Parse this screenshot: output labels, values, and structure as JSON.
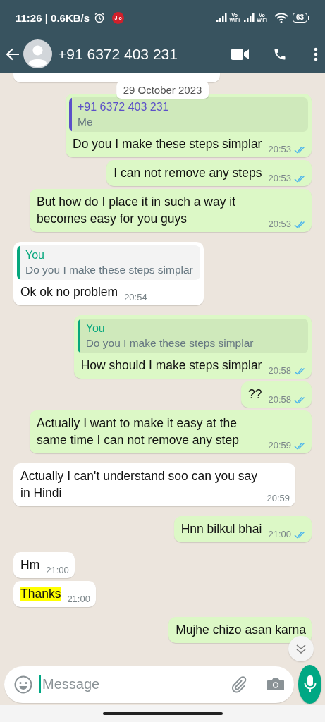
{
  "status_bar": {
    "time": "11:26 | 0.6KB/s",
    "carrier_badge": "Jio",
    "volte_labels": [
      {
        "top": "Vo",
        "bottom": "WiFi"
      },
      {
        "top": "Vo",
        "bottom": "WiFi"
      }
    ],
    "battery": "63"
  },
  "header": {
    "contact": "+91 6372 403 231"
  },
  "chat": {
    "top_partial_bubble": true,
    "date_chip": "29 October 2023",
    "scroll_down_button": true,
    "messages": [
      {
        "kind": "outgoing",
        "quote": {
          "author": "+91 6372 403 231",
          "text": "Me",
          "color": "#5b4fc9"
        },
        "text": "Do you I make these steps simplar",
        "time": "20:53",
        "read": true
      },
      {
        "kind": "outgoing",
        "text": "I can not remove any steps",
        "time": "20:53",
        "read": true
      },
      {
        "kind": "outgoing",
        "text": "But how do I place it in such a way it becomes easy for you guys",
        "time": "20:53",
        "read": true
      },
      {
        "kind": "incoming",
        "quote": {
          "author": "You",
          "text": "Do you I make these steps simplar",
          "color": "#06a77d"
        },
        "text": "Ok ok no problem",
        "time": "20:54"
      },
      {
        "kind": "outgoing",
        "quote": {
          "author": "You",
          "text": "Do you I make these steps simplar",
          "color": "#06a77d"
        },
        "text": "How should I make steps simplar",
        "time": "20:58",
        "read": true
      },
      {
        "kind": "outgoing",
        "text": "??",
        "time": "20:58",
        "read": true
      },
      {
        "kind": "outgoing",
        "text": "Actually I want to make it easy at the same time I can not remove any step",
        "time": "20:59",
        "read": true
      },
      {
        "kind": "incoming",
        "text": "Actually I can't understand soo can you say in Hindi",
        "time": "20:59"
      },
      {
        "kind": "outgoing",
        "text": "Hnn bilkul bhai",
        "time": "21:00",
        "read": true
      },
      {
        "kind": "incoming",
        "text": "Hm",
        "time": "21:00"
      },
      {
        "kind": "incoming",
        "text": "Thanks",
        "time": "21:00",
        "highlighted": true
      },
      {
        "kind": "outgoing",
        "text": "Mujhe chizo asan karna"
      }
    ]
  },
  "composer": {
    "placeholder": "Message"
  }
}
